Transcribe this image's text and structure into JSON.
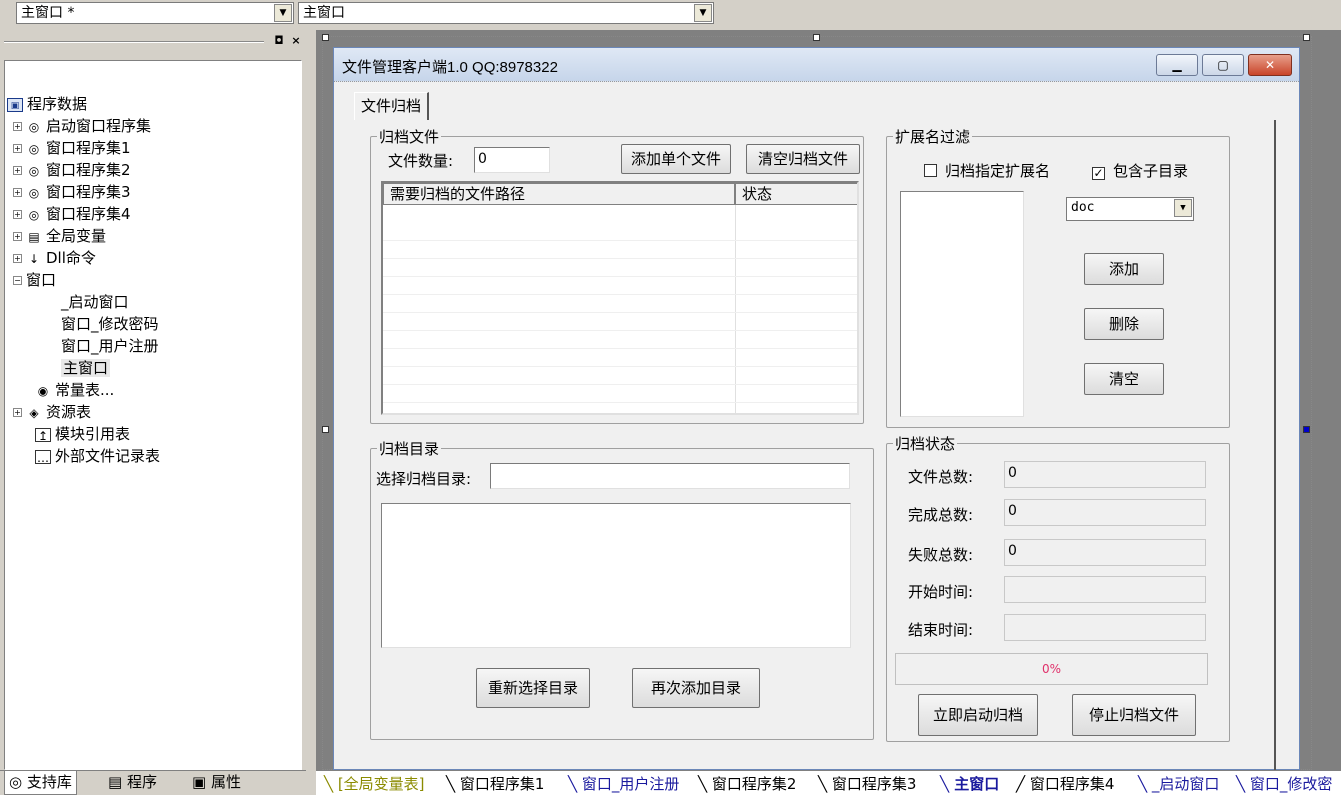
{
  "topbar": {
    "combo1": "主窗口 *",
    "combo2": "主窗口"
  },
  "left_panel": {
    "tree": [
      {
        "label": "程序数据",
        "icon": "program-data-icon"
      },
      {
        "label": "启动窗口程序集",
        "icon": "assembly-icon"
      },
      {
        "label": "窗口程序集1",
        "icon": "assembly-icon"
      },
      {
        "label": "窗口程序集2",
        "icon": "assembly-icon"
      },
      {
        "label": "窗口程序集3",
        "icon": "assembly-icon"
      },
      {
        "label": "窗口程序集4",
        "icon": "assembly-icon"
      },
      {
        "label": "全局变量",
        "icon": "global-var-icon"
      },
      {
        "label": "Dll命令",
        "icon": "dll-icon"
      },
      {
        "label": "窗口",
        "icon": "window-icon"
      },
      {
        "label": "_启动窗口",
        "icon": "window-icon"
      },
      {
        "label": "窗口_修改密码",
        "icon": "window-icon"
      },
      {
        "label": "窗口_用户注册",
        "icon": "window-icon"
      },
      {
        "label": "主窗口",
        "icon": "window-icon"
      },
      {
        "label": "常量表...",
        "icon": "constant-icon"
      },
      {
        "label": "资源表",
        "icon": "resource-icon"
      },
      {
        "label": "模块引用表",
        "icon": "module-icon"
      },
      {
        "label": "外部文件记录表",
        "icon": "file-record-icon"
      }
    ],
    "bottom_tabs": [
      "支持库",
      "程序",
      "属性"
    ]
  },
  "window": {
    "title": "文件管理客户端1.0    QQ:8978322",
    "tab": "文件归档",
    "archive_files": {
      "legend": "归档文件",
      "count_label": "文件数量:",
      "count_value": "0",
      "add_single": "添加单个文件",
      "clear": "清空归档文件",
      "col_path": "需要归档的文件路径",
      "col_status": "状态"
    },
    "ext_filter": {
      "legend": "扩展名过滤",
      "chk_ext": "归档指定扩展名",
      "chk_ext_checked": false,
      "chk_sub": "包含子目录",
      "chk_sub_checked": true,
      "combo_value": "doc",
      "btn_add": "添加",
      "btn_delete": "删除",
      "btn_clear": "清空"
    },
    "archive_dir": {
      "legend": "归档目录",
      "select_label": "选择归档目录:",
      "btn_reselect": "重新选择目录",
      "btn_add_again": "再次添加目录"
    },
    "archive_status": {
      "legend": "归档状态",
      "total_label": "文件总数:",
      "total_value": "0",
      "done_label": "完成总数:",
      "done_value": "0",
      "fail_label": "失败总数:",
      "fail_value": "0",
      "start_label": "开始时间:",
      "start_value": "",
      "end_label": "结束时间:",
      "end_value": "",
      "progress_text": "0%",
      "progress_value": 0,
      "btn_start": "立即启动归档",
      "btn_stop": "停止归档文件"
    }
  },
  "doc_tabs": [
    "[全局变量表]",
    "窗口程序集1",
    "窗口_用户注册",
    "窗口程序集2",
    "窗口程序集3",
    "主窗口",
    "窗口程序集4",
    "_启动窗口",
    "窗口_修改密"
  ]
}
